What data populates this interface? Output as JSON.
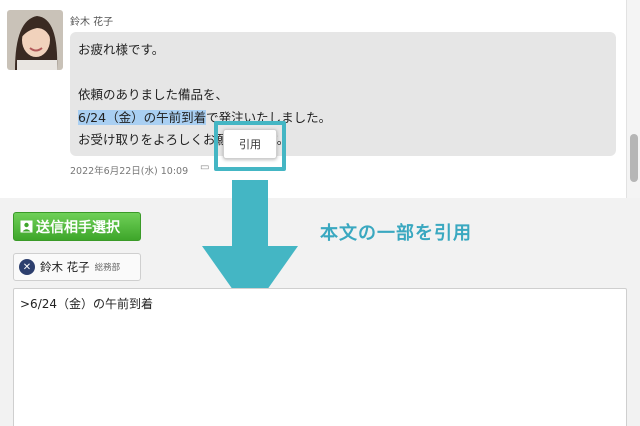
{
  "message": {
    "sender": "鈴木 花子",
    "lines": [
      "お疲れ様です。",
      "依頼のありました備品を、",
      "お受け取りをよろしくお願いします。"
    ],
    "highlighted_text": "6/24（金）の午前到着",
    "line3_rest": "で発注いたしました。",
    "timestamp": "2022年6月22日(水) 10:09"
  },
  "context_menu": {
    "quote_label": "引用"
  },
  "compose": {
    "send_target_label": "送信相手選択",
    "recipient": {
      "name": "鈴木 花子",
      "department": "総務部"
    },
    "body_value": ">6/24（金）の午前到着"
  },
  "annotation": {
    "text": "本文の一部を引用",
    "color": "#3aa8c0"
  },
  "colors": {
    "highlight": "#a9cff2",
    "accent": "#44b6c4",
    "send_button": "#4cb836"
  }
}
